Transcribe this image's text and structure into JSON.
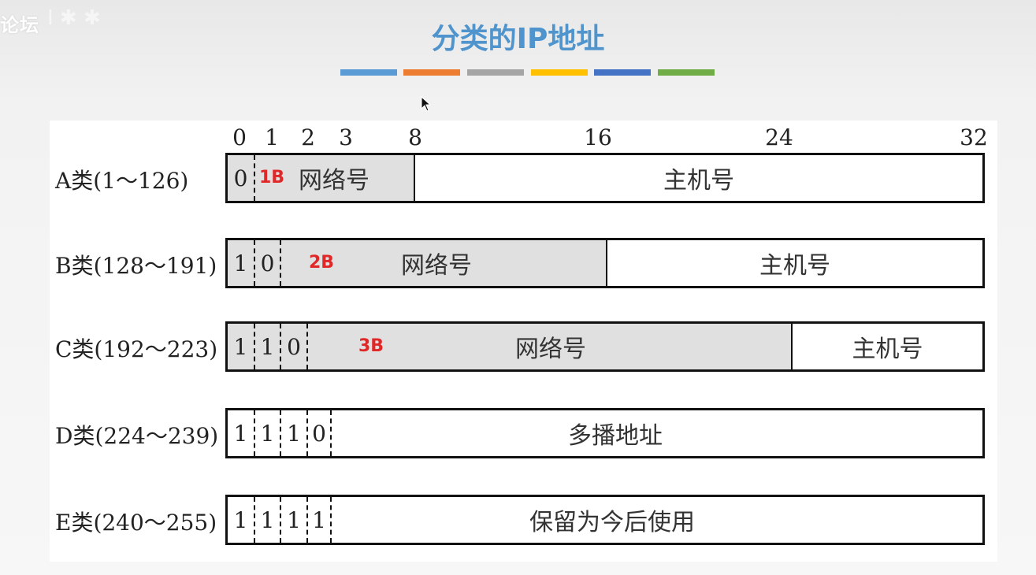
{
  "watermark": "论坛",
  "watermark_ghost": "I ✱ ✱",
  "title": "分类的IP地址",
  "color_bar": [
    "#5a9bd5",
    "#ed7d31",
    "#a5a5a5",
    "#ffc000",
    "#4472c4",
    "#70ad47"
  ],
  "bit_positions": [
    "0",
    "1",
    "2",
    "3",
    "8",
    "16",
    "24",
    "32"
  ],
  "rows": [
    {
      "label": "A类(1～126)",
      "bits": [
        "0"
      ],
      "bytes": "1B",
      "net": "网络号",
      "host": "主机号"
    },
    {
      "label": "B类(128～191)",
      "bits": [
        "1",
        "0"
      ],
      "bytes": "2B",
      "net": "网络号",
      "host": "主机号"
    },
    {
      "label": "C类(192～223)",
      "bits": [
        "1",
        "1",
        "0"
      ],
      "bytes": "3B",
      "net": "网络号",
      "host": "主机号"
    },
    {
      "label": "D类(224～239)",
      "bits": [
        "1",
        "1",
        "1",
        "0"
      ],
      "field": "多播地址"
    },
    {
      "label": "E类(240～255)",
      "bits": [
        "1",
        "1",
        "1",
        "1"
      ],
      "field": "保留为今后使用"
    }
  ]
}
